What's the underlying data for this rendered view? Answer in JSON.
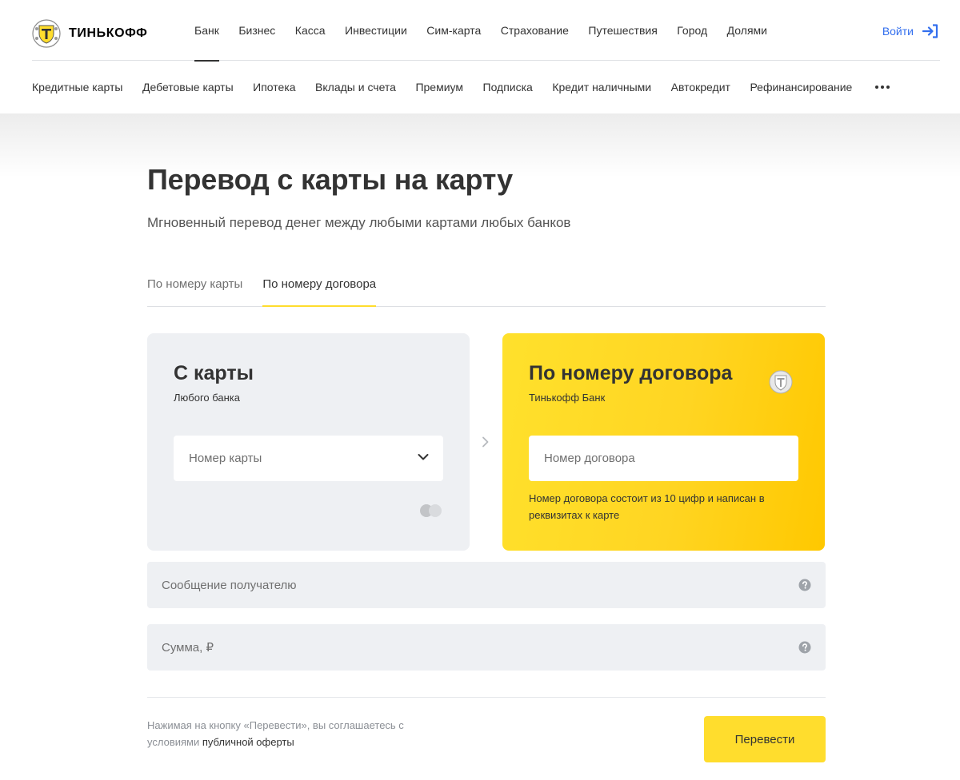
{
  "header": {
    "brand": "ТИНЬКОФФ",
    "top_nav": [
      {
        "label": "Банк",
        "active": true
      },
      {
        "label": "Бизнес",
        "active": false
      },
      {
        "label": "Касса",
        "active": false
      },
      {
        "label": "Инвестиции",
        "active": false
      },
      {
        "label": "Сим-карта",
        "active": false
      },
      {
        "label": "Страхование",
        "active": false
      },
      {
        "label": "Путешествия",
        "active": false
      },
      {
        "label": "Город",
        "active": false
      },
      {
        "label": "Долями",
        "active": false
      }
    ],
    "login_label": "Войти",
    "sub_nav": [
      "Кредитные карты",
      "Дебетовые карты",
      "Ипотека",
      "Вклады и счета",
      "Премиум",
      "Подписка",
      "Кредит наличными",
      "Автокредит",
      "Рефинансирование"
    ]
  },
  "page": {
    "title": "Перевод с карты на карту",
    "subtitle": "Мгновенный перевод денег между любыми картами любых банков"
  },
  "tabs": [
    {
      "label": "По номеру карты",
      "active": false
    },
    {
      "label": "По номеру договора",
      "active": true
    }
  ],
  "from_card": {
    "title": "С карты",
    "caption": "Любого банка",
    "card_number_placeholder": "Номер карты"
  },
  "to_card": {
    "title": "По номеру договора",
    "caption": "Тинькофф Банк",
    "contract_placeholder": "Номер договора",
    "hint": "Номер договора состоит из 10 цифр и написан в реквизитах к карте"
  },
  "message_placeholder": "Сообщение получателю",
  "amount_placeholder": "Сумма, ₽",
  "footer": {
    "legal_text": "Нажимая на кнопку «Перевести», вы соглашаетесь с условиями",
    "legal_link": "публичной оферты",
    "submit_label": "Перевести"
  },
  "colors": {
    "accent_yellow": "#ffdd2d",
    "link_blue": "#336fee",
    "field_gray": "#eef0f3"
  },
  "icons": {
    "logo": "tinkoff-shield-icon",
    "login": "sign-in-arrow-icon",
    "more": "more-dots-icon",
    "dropdown": "chevron-down-icon",
    "between": "chevron-right-icon",
    "help": "question-circle-icon",
    "payment_system": "payment-system-icon"
  }
}
